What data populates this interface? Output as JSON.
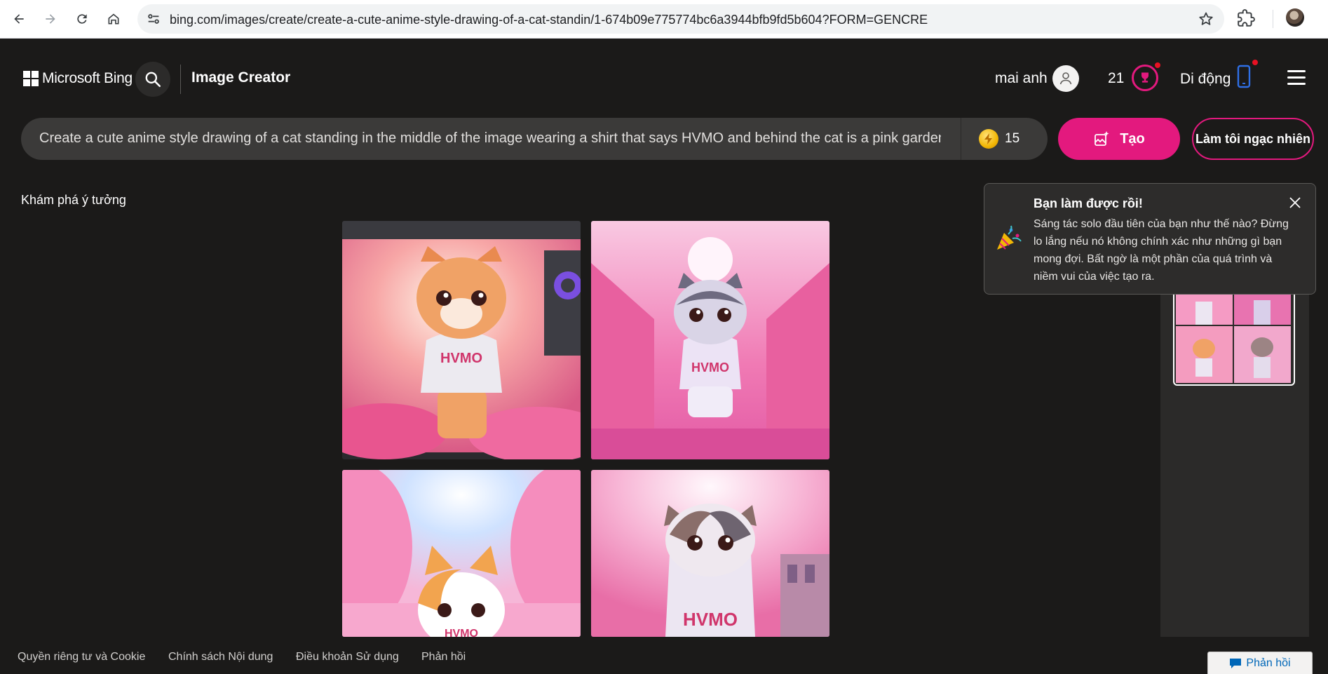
{
  "browser": {
    "url": "bing.com/images/create/create-a-cute-anime-style-drawing-of-a-cat-standin/1-674b09e775774bc6a3944bfb9fd5b604?FORM=GENCRE"
  },
  "header": {
    "brand": "Microsoft Bing",
    "product": "Image Creator",
    "user_name": "mai anh",
    "rewards_count": "21",
    "mobile_label": "Di động"
  },
  "prompt": {
    "text": "Create a cute anime style drawing of a cat standing in the middle of the image wearing a shirt that says HVMO and behind the cat is a pink garden",
    "boosts": "15",
    "create_label": "Tạo",
    "surprise_label": "Làm tôi ngạc nhiên"
  },
  "explore_label": "Khám phá ý tưởng",
  "images": [
    {
      "shirt_text": "HVMO",
      "cat_color": "orange"
    },
    {
      "shirt_text": "HVMO",
      "cat_color": "gray"
    },
    {
      "shirt_text": "HVMO",
      "cat_color": "orange-white"
    },
    {
      "shirt_text": "HVMO",
      "cat_color": "gray-brown"
    }
  ],
  "toast": {
    "title": "Bạn làm được rồi!",
    "body": "Sáng tác solo đầu tiên của bạn như thế nào? Đừng lo lắng nếu nó không chính xác như những gì bạn mong đợi. Bất ngờ là một phần của quá trình và niềm vui của việc tạo ra."
  },
  "footer": {
    "links": [
      "Quyền riêng tư và Cookie",
      "Chính sách Nội dung",
      "Điều khoản Sử dụng",
      "Phản hồi"
    ],
    "feedback_button": "Phản hồi"
  },
  "colors": {
    "background": "#1b1a19",
    "accent": "#e3197e",
    "prompt_bar": "#3b3a39"
  }
}
